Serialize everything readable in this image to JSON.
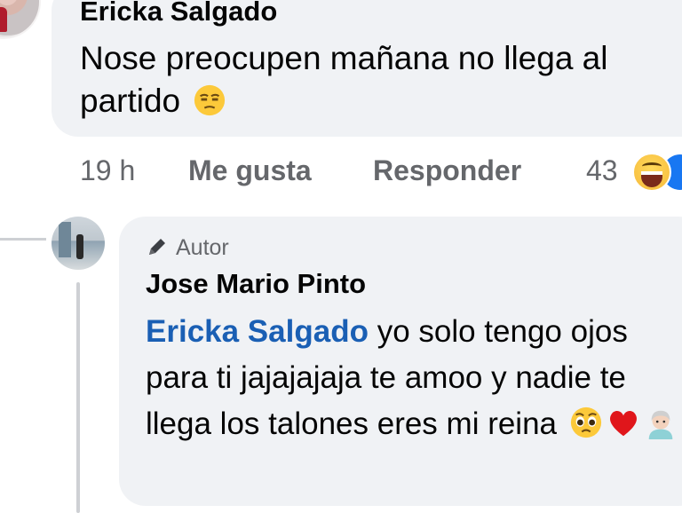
{
  "top_comment": {
    "author": "Ericka Salgado",
    "text": "Nose preocupen mañana no llega al partido"
  },
  "actions": {
    "time": "19 h",
    "like_label": "Me gusta",
    "reply_label": "Responder",
    "reaction_count": "43",
    "reaction_icons": [
      "grinning-sweat-emoji-icon",
      "like-reaction-icon"
    ]
  },
  "reply": {
    "badge_label": "Autor",
    "author": "Jose Mario Pinto",
    "mention": "Ericka Salgado",
    "text": "yo solo tengo ojos para ti jajajajaja te amoo y nadie te llega los talones eres mi reina"
  },
  "colors": {
    "bubble": "#f0f2f5",
    "mention": "#1a5fb4",
    "muted": "#65676b"
  }
}
